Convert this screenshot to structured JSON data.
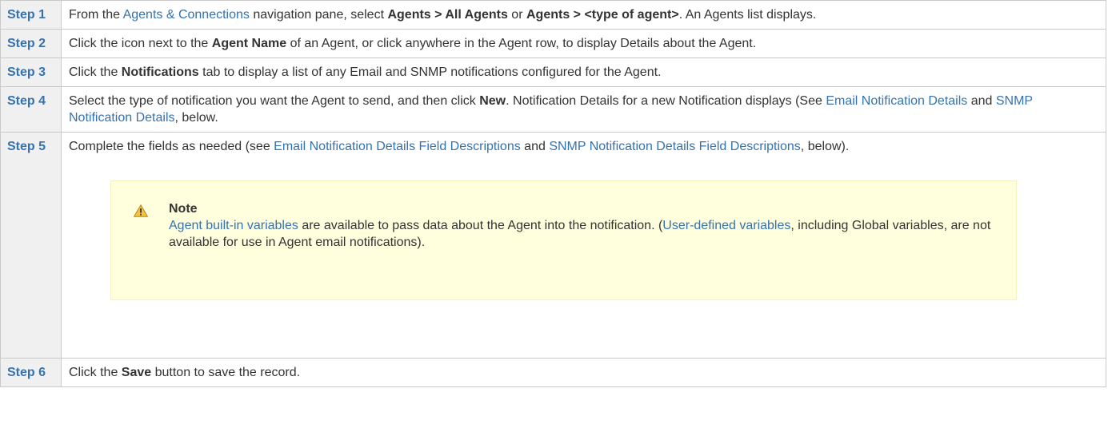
{
  "steps": [
    {
      "label": "Step 1",
      "parts": [
        {
          "t": "From the "
        },
        {
          "l": "Agents & Connections"
        },
        {
          "t": " navigation pane, select "
        },
        {
          "b": "Agents > All Agents"
        },
        {
          "t": " or "
        },
        {
          "b": "Agents > <type of agent>"
        },
        {
          "t": ". An Agents list displays."
        }
      ]
    },
    {
      "label": "Step 2",
      "parts": [
        {
          "t": "Click the icon next to the "
        },
        {
          "b": "Agent Name"
        },
        {
          "t": " of an Agent, or click anywhere in the Agent row, to display Details about the Agent."
        }
      ]
    },
    {
      "label": "Step 3",
      "parts": [
        {
          "t": "Click the "
        },
        {
          "b": "Notifications"
        },
        {
          "t": " tab to display a list of any Email and SNMP notifications configured for the Agent."
        }
      ]
    },
    {
      "label": "Step 4",
      "parts": [
        {
          "t": "Select the type of notification you want the Agent to send, and then click "
        },
        {
          "b": "New"
        },
        {
          "t": ". Notification Details for a new Notification displays (See "
        },
        {
          "l": "Email Notification Details"
        },
        {
          "t": " and "
        },
        {
          "l": "SNMP Notification Details"
        },
        {
          "t": ", below."
        }
      ]
    },
    {
      "label": "Step 5",
      "parts": [
        {
          "t": "Complete the fields as needed (see "
        },
        {
          "l": "Email Notification Details Field Descriptions"
        },
        {
          "t": " and "
        },
        {
          "l": "SNMP Notification Details Field Descriptions"
        },
        {
          "t": ", below)."
        }
      ]
    },
    {
      "label": "Step 6",
      "parts": [
        {
          "t": "Click the "
        },
        {
          "b": "Save"
        },
        {
          "t": " button to save the record."
        }
      ]
    }
  ],
  "note": {
    "title": "Note",
    "parts": [
      {
        "l": "Agent built-in variables"
      },
      {
        "t": " are available to pass data about the Agent into the notification. ("
      },
      {
        "l": "User-defined variables"
      },
      {
        "t": ", including Global variables, are not available for use in Agent email notifications)."
      }
    ]
  },
  "icons": {
    "note": "warning-triangle-icon"
  },
  "colors": {
    "link": "#3572b0",
    "step_label_bg": "#f0f0f0",
    "note_bg": "#ffffdd",
    "warning": "#f5a623"
  }
}
